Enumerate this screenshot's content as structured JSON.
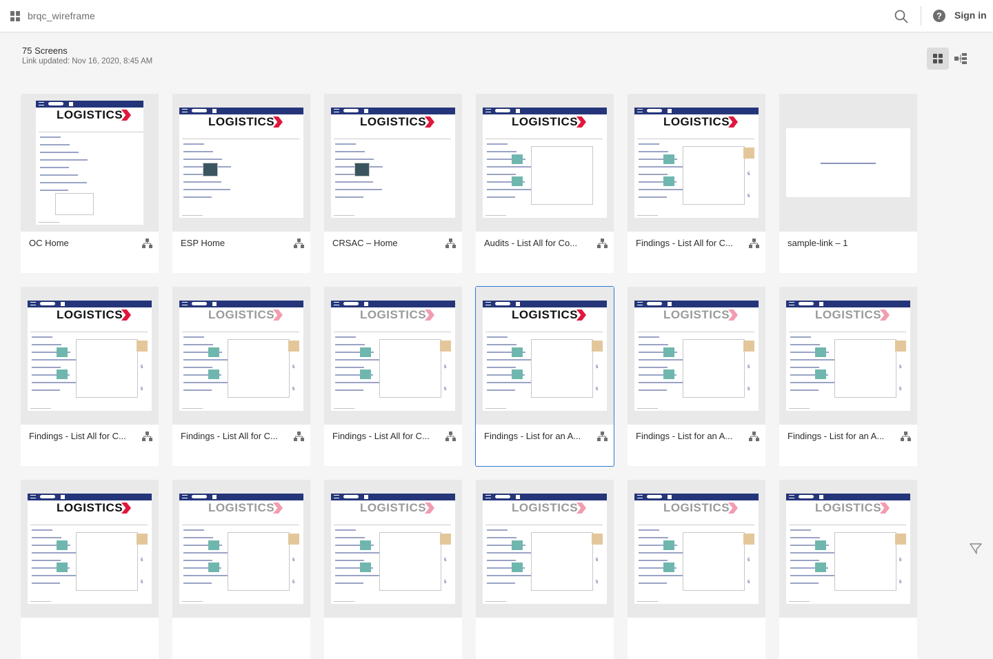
{
  "header": {
    "project_title": "brqc_wireframe",
    "search_icon": "search-icon",
    "help_icon": "help-icon",
    "sign_in_label": "Sign in"
  },
  "summary": {
    "screen_count": "75 Screens",
    "link_updated": "Link updated: Nov 16, 2020, 8:45 AM"
  },
  "view_toggle": {
    "grid_icon": "grid-view-icon",
    "flow_icon": "flow-view-icon",
    "active": "grid"
  },
  "colors": {
    "accent_selected": "#2d7ad6",
    "wireframe_navy": "#24357a",
    "logo_red": "#e0173c"
  },
  "screens": [
    {
      "label": "OC Home",
      "thumb_logo": "LOGISTICS"
    },
    {
      "label": "ESP Home",
      "thumb_logo": "LOGISTICS"
    },
    {
      "label": "CRSAC – Home",
      "thumb_logo": "LOGISTICS"
    },
    {
      "label": "Audits - List All for Co...",
      "thumb_logo": "LOGISTICS"
    },
    {
      "label": "Findings - List All for C...",
      "thumb_logo": "LOGISTICS"
    },
    {
      "label": "sample-link – 1",
      "thumb_logo": ""
    },
    {
      "label": "Findings - List All for C...",
      "thumb_logo": "LOGISTICS"
    },
    {
      "label": "Findings - List All for C...",
      "thumb_logo": "LOGISTICS"
    },
    {
      "label": "Findings - List All for C...",
      "thumb_logo": "LOGISTICS"
    },
    {
      "label": "Findings - List for an A...",
      "thumb_logo": "LOGISTICS",
      "selected": true
    },
    {
      "label": "Findings - List for an A...",
      "thumb_logo": "LOGISTICS"
    },
    {
      "label": "Findings - List for an A...",
      "thumb_logo": "LOGISTICS"
    },
    {
      "label": "",
      "thumb_logo": "LOGISTICS"
    },
    {
      "label": "",
      "thumb_logo": "LOGISTICS"
    },
    {
      "label": "",
      "thumb_logo": "LOGISTICS"
    },
    {
      "label": "",
      "thumb_logo": "LOGISTICS"
    },
    {
      "label": "",
      "thumb_logo": "LOGISTICS"
    },
    {
      "label": "",
      "thumb_logo": "LOGISTICS"
    }
  ],
  "feedback_icon": "feedback-icon"
}
